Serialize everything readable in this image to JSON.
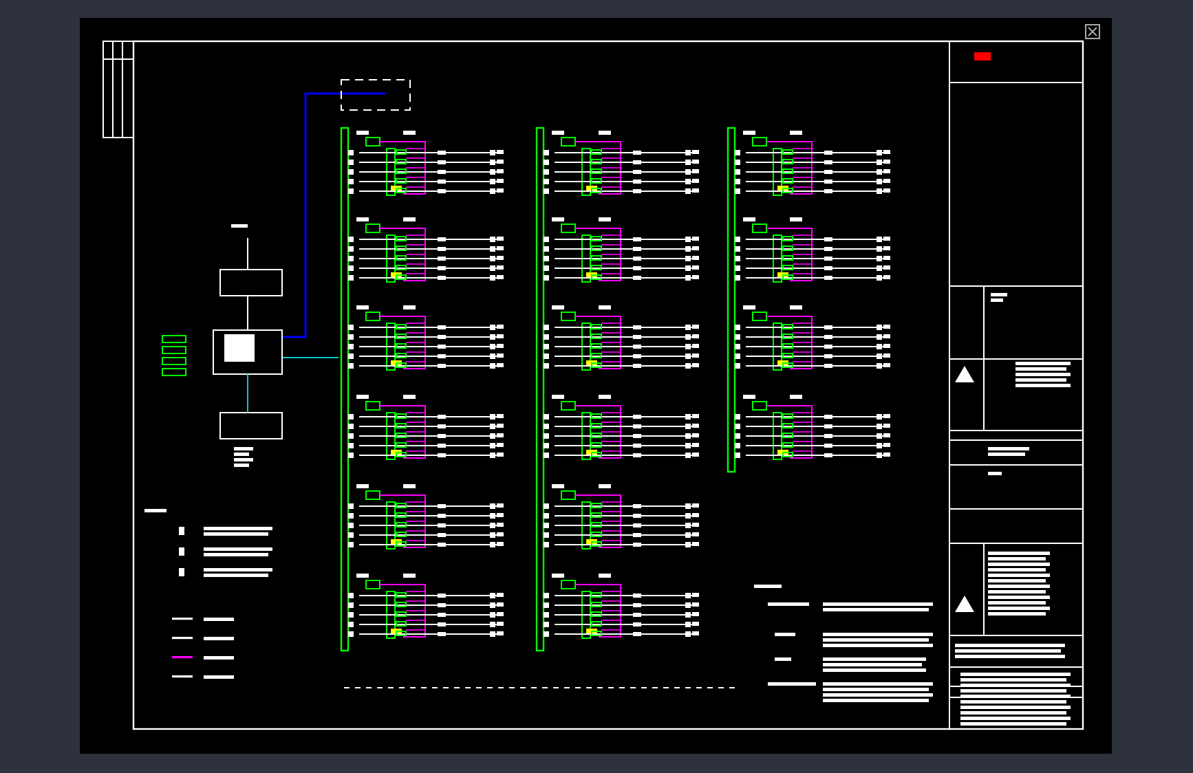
{
  "drawing": {
    "risers": [
      {
        "color": "#00ff00",
        "panels": [
          {
            "kind": "distribution"
          },
          {
            "kind": "distribution"
          },
          {
            "kind": "distribution"
          },
          {
            "kind": "distribution"
          },
          {
            "kind": "distribution"
          },
          {
            "kind": "distribution"
          }
        ]
      },
      {
        "color": "#00ff00",
        "panels": [
          {
            "kind": "distribution"
          },
          {
            "kind": "distribution"
          },
          {
            "kind": "distribution"
          },
          {
            "kind": "distribution"
          },
          {
            "kind": "distribution"
          },
          {
            "kind": "distribution"
          }
        ]
      },
      {
        "color": "#00ff00",
        "panels": [
          {
            "kind": "distribution"
          },
          {
            "kind": "distribution"
          },
          {
            "kind": "distribution"
          },
          {
            "kind": "distribution"
          }
        ]
      }
    ],
    "legend": [
      {
        "color": "#ffffff"
      },
      {
        "color": "#ffffff"
      },
      {
        "color": "#ff00ff"
      },
      {
        "color": "#ffffff"
      }
    ]
  }
}
